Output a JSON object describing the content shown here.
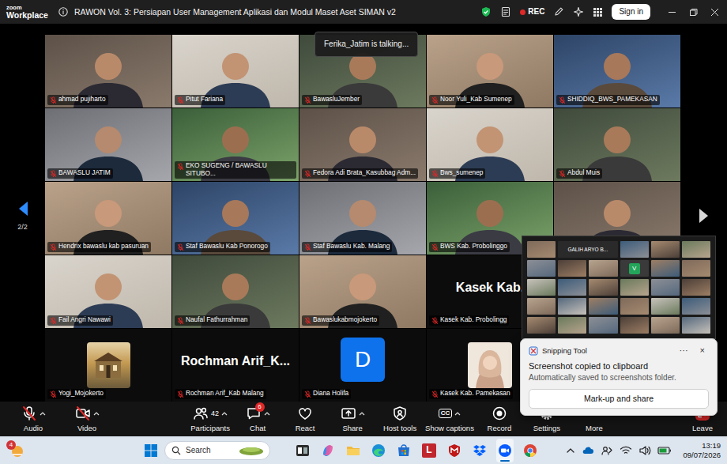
{
  "window": {
    "logo": {
      "top": "zoom",
      "bottom": "Workplace"
    },
    "title": "RAWON Vol. 3: Persiapan User Management Aplikasi dan Modul Maset Aset SIMAN v2",
    "recording": {
      "label": "REC",
      "on": true
    },
    "sign_in": "Sign in"
  },
  "talking": "Ferika_Jatim is talking...",
  "gallery": {
    "page": "2/2",
    "prev_enabled": true,
    "next_enabled": false,
    "tiles": [
      {
        "name": "ahmad pujiharto",
        "kind": "video",
        "muted": true
      },
      {
        "name": "Pitut Fariana",
        "kind": "video",
        "muted": true
      },
      {
        "name": "BawasluJember",
        "kind": "video",
        "muted": true
      },
      {
        "name": "Noor Yuli_Kab Sumenep",
        "kind": "video",
        "muted": true
      },
      {
        "name": "SHIDDIQ_BWS_PAMEKASAN",
        "kind": "video",
        "muted": true
      },
      {
        "name": "BAWASLU JATIM",
        "kind": "video",
        "muted": true
      },
      {
        "name": "EKO SUGENG / BAWASLU SITUBO...",
        "kind": "video",
        "muted": true
      },
      {
        "name": "Fedora Adi Brata_Kasubbag Adm...",
        "kind": "video",
        "muted": true
      },
      {
        "name": "Bws_sumenep",
        "kind": "video",
        "muted": true
      },
      {
        "name": "Abdul Muis",
        "kind": "video",
        "muted": true
      },
      {
        "name": "Hendrix bawaslu kab pasuruan",
        "kind": "video",
        "muted": true
      },
      {
        "name": "Staf Bawaslu Kab Ponorogo",
        "kind": "video",
        "muted": true
      },
      {
        "name": "Staf Bawaslu Kab. Malang",
        "kind": "video",
        "muted": true
      },
      {
        "name": "BWS Kab. Probolinggo",
        "kind": "video",
        "muted": true
      },
      {
        "kind": "video"
      },
      {
        "name": "Fail Angri Nawawi",
        "kind": "video",
        "muted": true
      },
      {
        "name": "Naufal Fathurrahman",
        "kind": "video",
        "muted": true
      },
      {
        "name": "Bawaslukabmojokerto",
        "kind": "video",
        "muted": true
      },
      {
        "name": "Kasek Kab. Probolingg",
        "kind": "name",
        "display": "Kasek Kab.",
        "muted": true
      },
      {
        "kind": "video"
      },
      {
        "name": "Yogi_Mojokerto",
        "kind": "picture",
        "muted": true
      },
      {
        "name": "Rochman Arif_Kab Malang",
        "kind": "name",
        "display": "Rochman Arif_K...",
        "muted": true
      },
      {
        "name": "Diana Holifa",
        "kind": "initial",
        "display": "D",
        "muted": true
      },
      {
        "name": "Kasek Kab. Pamekasan",
        "kind": "avatar",
        "muted": true
      }
    ]
  },
  "mini_window": {
    "label": "GALIH ARYO B...",
    "badge": "V"
  },
  "toolbar": [
    {
      "label": "Audio",
      "kind": "audio",
      "muted": true,
      "caret": true
    },
    {
      "label": "Video",
      "kind": "video",
      "off": true,
      "caret": true
    },
    {
      "label": "Participants",
      "kind": "participants",
      "count": "42",
      "caret": true
    },
    {
      "label": "Chat",
      "kind": "chat",
      "badge": "6",
      "caret": true
    },
    {
      "label": "React",
      "kind": "react",
      "caret": false
    },
    {
      "label": "Share",
      "kind": "share",
      "caret": true
    },
    {
      "label": "Host tools",
      "kind": "host",
      "caret": false
    },
    {
      "label": "Show captions",
      "kind": "captions",
      "icon_text": "CC",
      "caret": true
    },
    {
      "label": "Record",
      "kind": "record",
      "caret": false
    },
    {
      "label": "Settings",
      "kind": "settings",
      "caret": false
    },
    {
      "label": "More",
      "kind": "more",
      "caret": false
    },
    {
      "label": "Leave",
      "kind": "leave",
      "caret": false
    }
  ],
  "notification": {
    "app": "Snipping Tool",
    "menu": "···",
    "close": "×",
    "title": "Screenshot copied to clipboard",
    "message": "Automatically saved to screenshots folder.",
    "button": "Mark-up and share"
  },
  "taskbar": {
    "widget_badge": "4",
    "search": "Search",
    "apps": [
      {
        "selected": false
      },
      {
        "selected": false
      },
      {
        "selected": false
      },
      {
        "selected": false
      },
      {
        "selected": false
      },
      {
        "selected": false,
        "icon_text": "L"
      },
      {
        "selected": false
      },
      {
        "selected": false
      },
      {
        "selected": true
      },
      {
        "selected": false
      }
    ],
    "time": "13:19",
    "date": "09/07/2026"
  }
}
